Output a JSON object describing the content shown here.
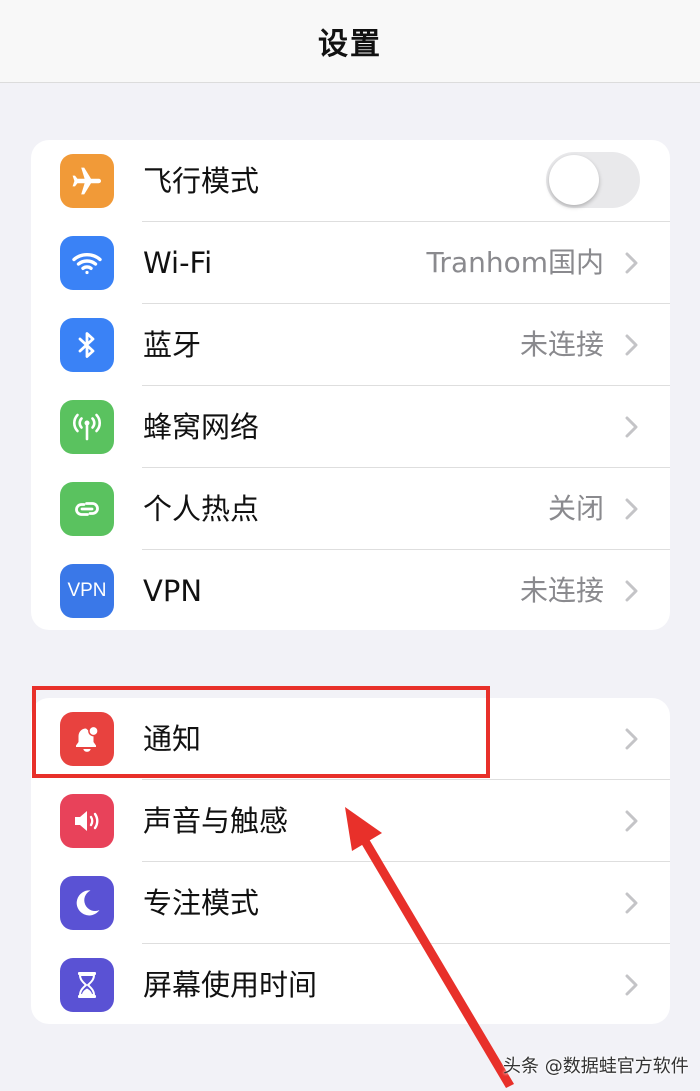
{
  "nav": {
    "title": "设置"
  },
  "group1": [
    {
      "label": "飞行模式",
      "icon": "airplane-icon",
      "color": "#f19a38",
      "control": "toggle",
      "toggle_on": false
    },
    {
      "label": "Wi-Fi",
      "value": "Tranhom国内",
      "icon": "wifi-icon",
      "color": "#3a82f6"
    },
    {
      "label": "蓝牙",
      "value": "未连接",
      "icon": "bluetooth-icon",
      "color": "#3a82f6"
    },
    {
      "label": "蜂窝网络",
      "icon": "cellular-icon",
      "color": "#5ac25f"
    },
    {
      "label": "个人热点",
      "value": "关闭",
      "icon": "hotspot-icon",
      "color": "#5ac25f"
    },
    {
      "label": "VPN",
      "value": "未连接",
      "icon": "vpn-icon",
      "icon_text": "VPN",
      "color": "#3a78e8"
    }
  ],
  "group2": [
    {
      "label": "通知",
      "icon": "bell-icon",
      "color": "#e8423f"
    },
    {
      "label": "声音与触感",
      "icon": "speaker-icon",
      "color": "#e8425a"
    },
    {
      "label": "专注模式",
      "icon": "moon-icon",
      "color": "#5a52d4"
    },
    {
      "label": "屏幕使用时间",
      "icon": "hourglass-icon",
      "color": "#5a52d4"
    }
  ],
  "annotation": {
    "highlight_color": "#e8302a"
  },
  "watermark": "头条 @数据蛙官方软件"
}
